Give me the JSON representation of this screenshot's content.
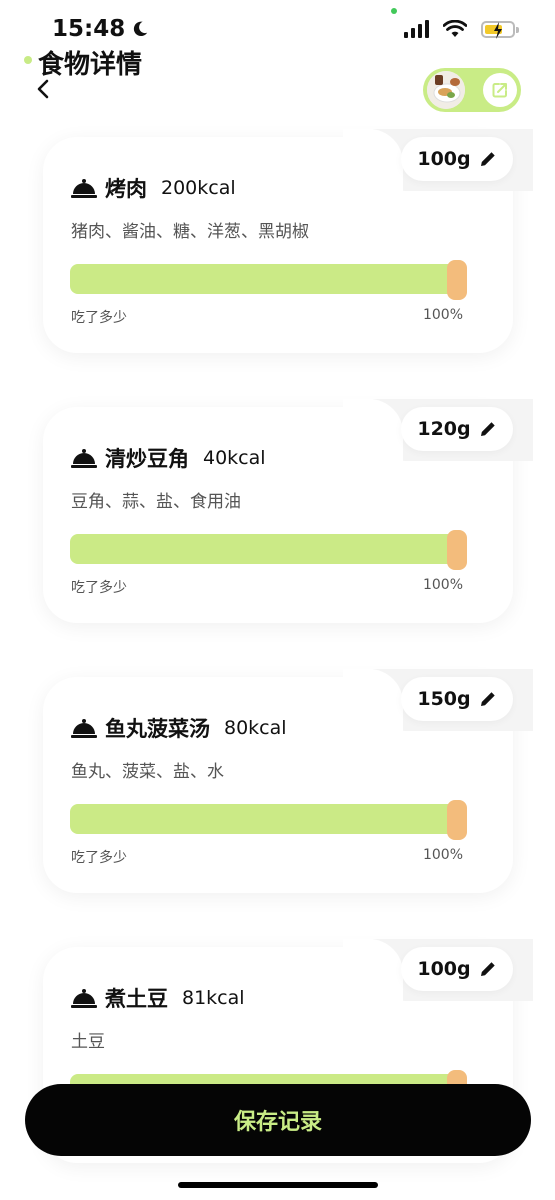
{
  "status_bar": {
    "time": "15:48"
  },
  "header": {
    "title": "食物详情"
  },
  "foods": [
    {
      "name": "烤肉",
      "kcal": "200kcal",
      "weight": "100g",
      "ingredients": "猪肉、酱油、糖、洋葱、黑胡椒",
      "slider_label": "吃了多少",
      "percent": "100%",
      "eaten_fraction": 1.0
    },
    {
      "name": "清炒豆角",
      "kcal": "40kcal",
      "weight": "120g",
      "ingredients": "豆角、蒜、盐、食用油",
      "slider_label": "吃了多少",
      "percent": "100%",
      "eaten_fraction": 1.0
    },
    {
      "name": "鱼丸菠菜汤",
      "kcal": "80kcal",
      "weight": "150g",
      "ingredients": "鱼丸、菠菜、盐、水",
      "slider_label": "吃了多少",
      "percent": "100%",
      "eaten_fraction": 1.0
    },
    {
      "name": "煮土豆",
      "kcal": "81kcal",
      "weight": "100g",
      "ingredients": "土豆",
      "eaten_fraction": 1.0
    }
  ],
  "save_button": {
    "label": "保存记录"
  },
  "colors": {
    "accent": "#c9ec86",
    "handle": "#f3bc7c",
    "button_bg": "#050505"
  },
  "icons": [
    "moon-icon",
    "signal-icon",
    "wifi-icon",
    "battery-icon",
    "back-arrow-icon",
    "share-icon",
    "food-cloche-icon",
    "pencil-icon"
  ]
}
